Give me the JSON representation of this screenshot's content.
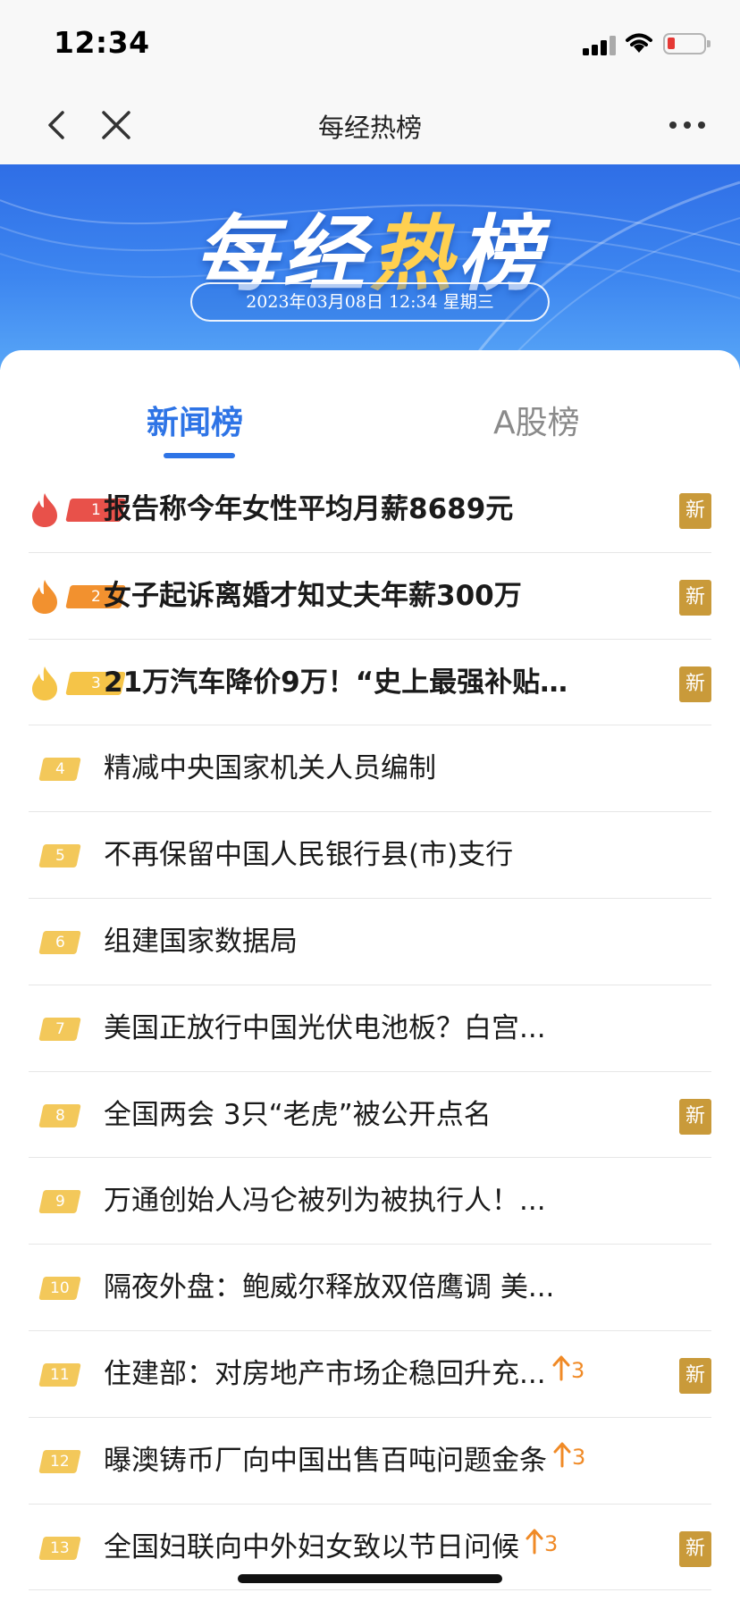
{
  "status_bar": {
    "time": "12:34"
  },
  "nav": {
    "title": "每经热榜"
  },
  "banner": {
    "title_left": "每经",
    "title_flame": "热",
    "title_right": "榜",
    "datetime": "2023年03月08日 12:34 星期三"
  },
  "tabs": [
    {
      "label": "新闻榜",
      "active": true
    },
    {
      "label": "A股榜",
      "active": false
    }
  ],
  "colors": {
    "accent": "#2e74e6",
    "rank1": "#e8514a",
    "rank2": "#f2912f",
    "rank3": "#f5c448",
    "new_badge": "#c99a3a",
    "trend": "#f08a26"
  },
  "list": [
    {
      "rank": "1",
      "title": "报告称今年女性平均月薪8689元",
      "new": "新"
    },
    {
      "rank": "2",
      "title": "女子起诉离婚才知丈夫年薪300万",
      "new": "新"
    },
    {
      "rank": "3",
      "title": "21万汽车降价9万！“史上最强补贴...",
      "new": "新"
    },
    {
      "rank": "4",
      "title": "精减中央国家机关人员编制"
    },
    {
      "rank": "5",
      "title": "不再保留中国人民银行县(市)支行"
    },
    {
      "rank": "6",
      "title": "组建国家数据局"
    },
    {
      "rank": "7",
      "title": "美国正放行中国光伏电池板？白宫..."
    },
    {
      "rank": "8",
      "title": "全国两会 3只“老虎”被公开点名",
      "new": "新"
    },
    {
      "rank": "9",
      "title": "万通创始人冯仑被列为被执行人！..."
    },
    {
      "rank": "10",
      "title": "隔夜外盘：鲍威尔释放双倍鹰调 美..."
    },
    {
      "rank": "11",
      "title": "住建部：对房地产市场企稳回升充...",
      "trend": "3",
      "new": "新"
    },
    {
      "rank": "12",
      "title": "曝澳铸币厂向中国出售百吨问题金条",
      "trend": "3"
    },
    {
      "rank": "13",
      "title": "全国妇联向中外妇女致以节日问候",
      "trend": "3",
      "new": "新"
    }
  ]
}
